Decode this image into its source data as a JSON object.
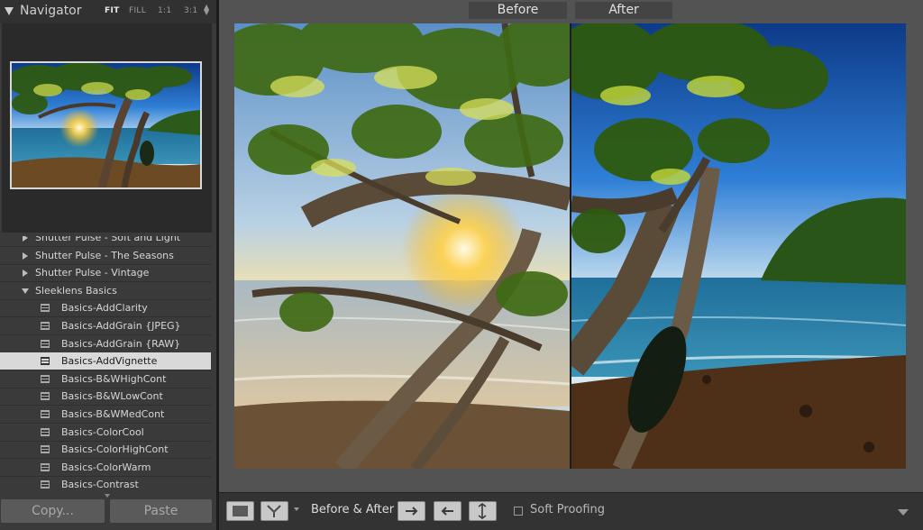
{
  "navigator": {
    "title": "Navigator",
    "zoom_fit": "FIT",
    "zoom_fill": "FILL",
    "zoom_1_1": "1:1",
    "zoom_3_1": "3:1",
    "arrows": "⬍"
  },
  "presets": {
    "groups": [
      {
        "label": "Shutter Pulse - Soft and Light",
        "expanded": false
      },
      {
        "label": "Shutter Pulse - The Seasons",
        "expanded": false
      },
      {
        "label": "Shutter Pulse - Vintage",
        "expanded": false
      },
      {
        "label": "Sleeklens Basics",
        "expanded": true
      }
    ],
    "items": [
      "Basics-AddClarity",
      "Basics-AddGrain {JPEG}",
      "Basics-AddGrain {RAW}",
      "Basics-AddVignette",
      "Basics-B&WHighCont",
      "Basics-B&WLowCont",
      "Basics-B&WMedCont",
      "Basics-ColorCool",
      "Basics-ColorHighCont",
      "Basics-ColorWarm",
      "Basics-Contrast"
    ],
    "selected_item": "Basics-AddVignette"
  },
  "buttons": {
    "copy": "Copy...",
    "paste": "Paste"
  },
  "compare": {
    "before_label": "Before",
    "after_label": "After"
  },
  "toolbar": {
    "before_after_label": "Before & After :",
    "soft_proofing": "Soft Proofing"
  }
}
